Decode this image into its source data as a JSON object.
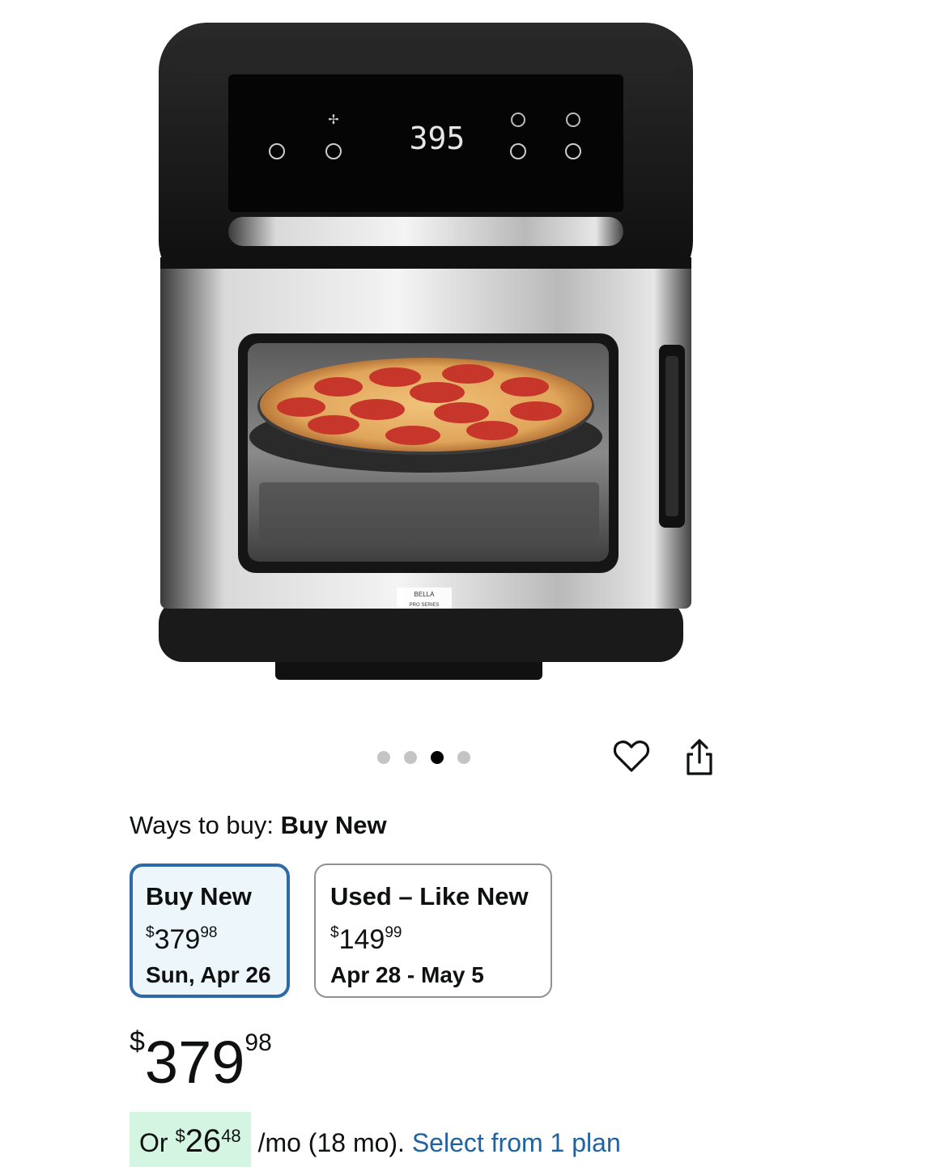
{
  "product": {
    "image_name": "air fryer oven with pizza",
    "display_temp": "395",
    "brand_text": "BELLA",
    "brand_sub": "PRO SERIES"
  },
  "carousel": {
    "count": 4,
    "active_index": 2
  },
  "actions": {
    "wishlist_icon": "heart-icon",
    "share_icon": "share-icon"
  },
  "ways_to_buy": {
    "label": "Ways to buy:",
    "selected": "Buy New"
  },
  "options": [
    {
      "title": "Buy New",
      "currency": "$",
      "whole": "379",
      "cents": "98",
      "date": "Sun, Apr 26"
    },
    {
      "title": "Used – Like New",
      "currency": "$",
      "whole": "149",
      "cents": "99",
      "date": "Apr 28 - May 5"
    }
  ],
  "price": {
    "currency": "$",
    "whole": "379",
    "cents": "98"
  },
  "financing": {
    "prefix": "Or",
    "currency": "$",
    "whole": "26",
    "cents": "48",
    "suffix": "/mo (18 mo).",
    "link": "Select from 1 plan"
  },
  "colors": {
    "selected_border": "#2e6aa7",
    "link": "#2162a1",
    "highlight": "#d5f5e3"
  }
}
